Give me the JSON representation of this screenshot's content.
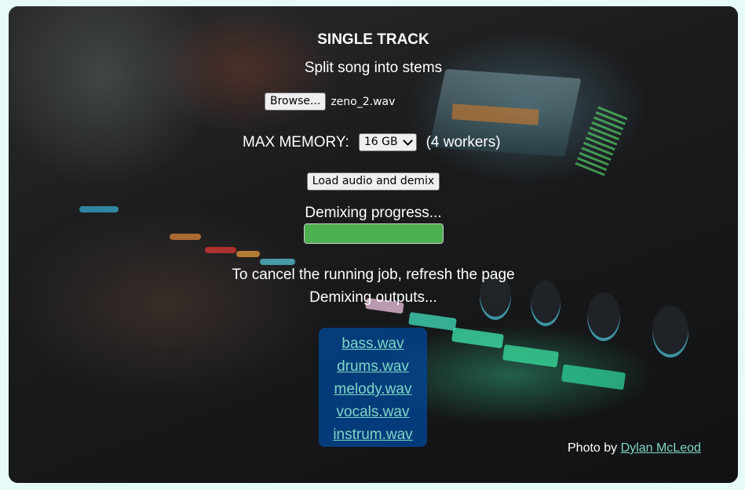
{
  "card": {
    "title": "SINGLE TRACK",
    "subtitle": "Split song into stems"
  },
  "file_input": {
    "button_label": "Browse...",
    "filename": "zeno_2.wav"
  },
  "memory": {
    "label": "MAX MEMORY:",
    "selected": "16 GB",
    "workers": "(4 workers)"
  },
  "actions": {
    "load_label": "Load audio and demix"
  },
  "progress": {
    "label": "Demixing progress...",
    "percent": 100,
    "color": "#4caf50"
  },
  "notice": {
    "cancel_text": "To cancel the running job, refresh the page"
  },
  "outputs": {
    "label": "Demixing outputs...",
    "files": [
      "bass.wav",
      "drums.wav",
      "melody.wav",
      "vocals.wav",
      "instrum.wav"
    ],
    "link_color": "#7fd6c6",
    "box_color": "#00468f"
  },
  "credit": {
    "prefix": "Photo by",
    "author": "Dylan McLeod"
  },
  "colors": {
    "page_background": "#e6fafa",
    "card_background": "#1c1d1f"
  }
}
